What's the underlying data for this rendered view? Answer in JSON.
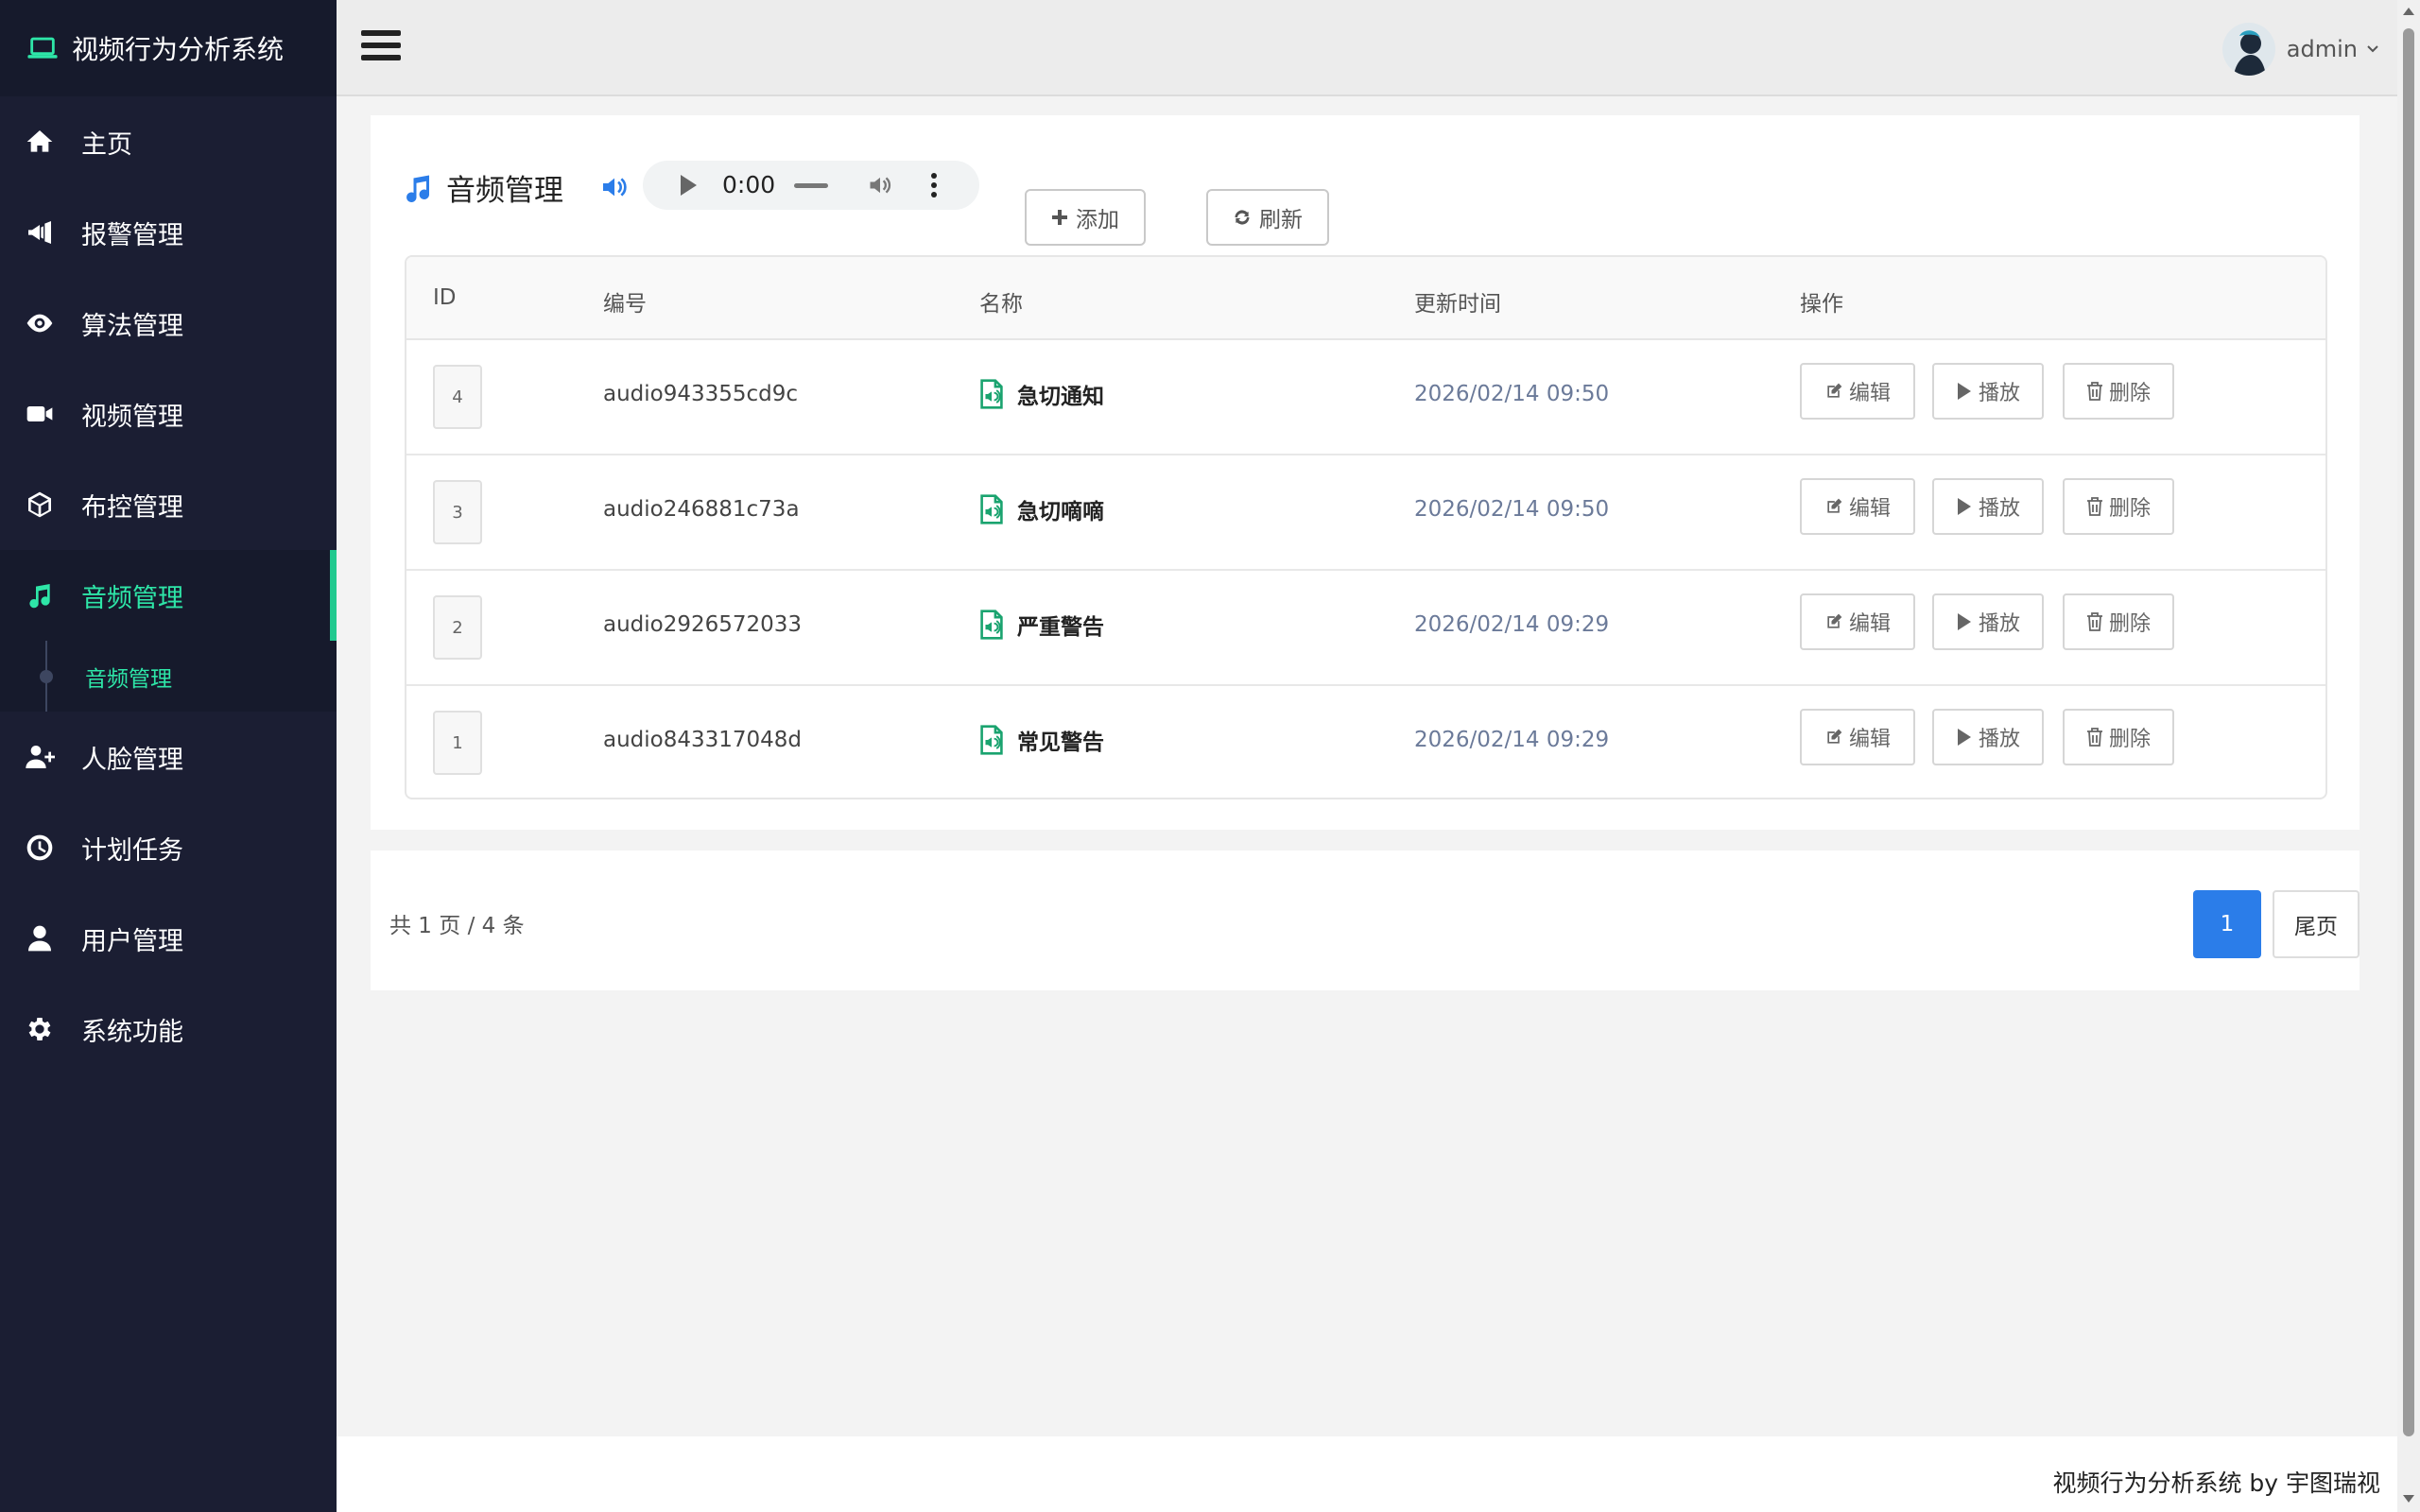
{
  "app": {
    "title": "视频行为分析系统",
    "user": "admin",
    "footer": "视频行为分析系统 by 宇图瑞视"
  },
  "sidebar": {
    "items": [
      {
        "label": "主页",
        "icon": "home-icon"
      },
      {
        "label": "报警管理",
        "icon": "megaphone-icon"
      },
      {
        "label": "算法管理",
        "icon": "eye-icon"
      },
      {
        "label": "视频管理",
        "icon": "video-camera-icon"
      },
      {
        "label": "布控管理",
        "icon": "cube-icon"
      },
      {
        "label": "音频管理",
        "icon": "music-icon",
        "active": true
      },
      {
        "label": "人脸管理",
        "icon": "user-plus-icon"
      },
      {
        "label": "计划任务",
        "icon": "clock-icon"
      },
      {
        "label": "用户管理",
        "icon": "user-icon"
      },
      {
        "label": "系统功能",
        "icon": "gear-icon"
      }
    ],
    "sub_item": "音频管理"
  },
  "main": {
    "title": "音频管理",
    "player_time": "0:00",
    "add_label": "添加",
    "refresh_label": "刷新",
    "table": {
      "headers": [
        "ID",
        "编号",
        "名称",
        "更新时间",
        "操作"
      ],
      "rows": [
        {
          "id": "4",
          "code": "audio943355cd9c",
          "name": "急切通知",
          "time": "2026/02/14 09:50"
        },
        {
          "id": "3",
          "code": "audio246881c73a",
          "name": "急切嘀嘀",
          "time": "2026/02/14 09:50"
        },
        {
          "id": "2",
          "code": "audio2926572033",
          "name": "严重警告",
          "time": "2026/02/14 09:29"
        },
        {
          "id": "1",
          "code": "audio843317048d",
          "name": "常见警告",
          "time": "2026/02/14 09:29"
        }
      ],
      "actions": {
        "edit": "编辑",
        "play": "播放",
        "delete": "删除"
      }
    },
    "pagination": {
      "info": "共 1 页 / 4 条",
      "current": "1",
      "last_label": "尾页"
    }
  },
  "colors": {
    "sidebar_bg": "#1b1e33",
    "accent_green": "#2ee6a8",
    "primary_blue": "#2b7de9"
  }
}
